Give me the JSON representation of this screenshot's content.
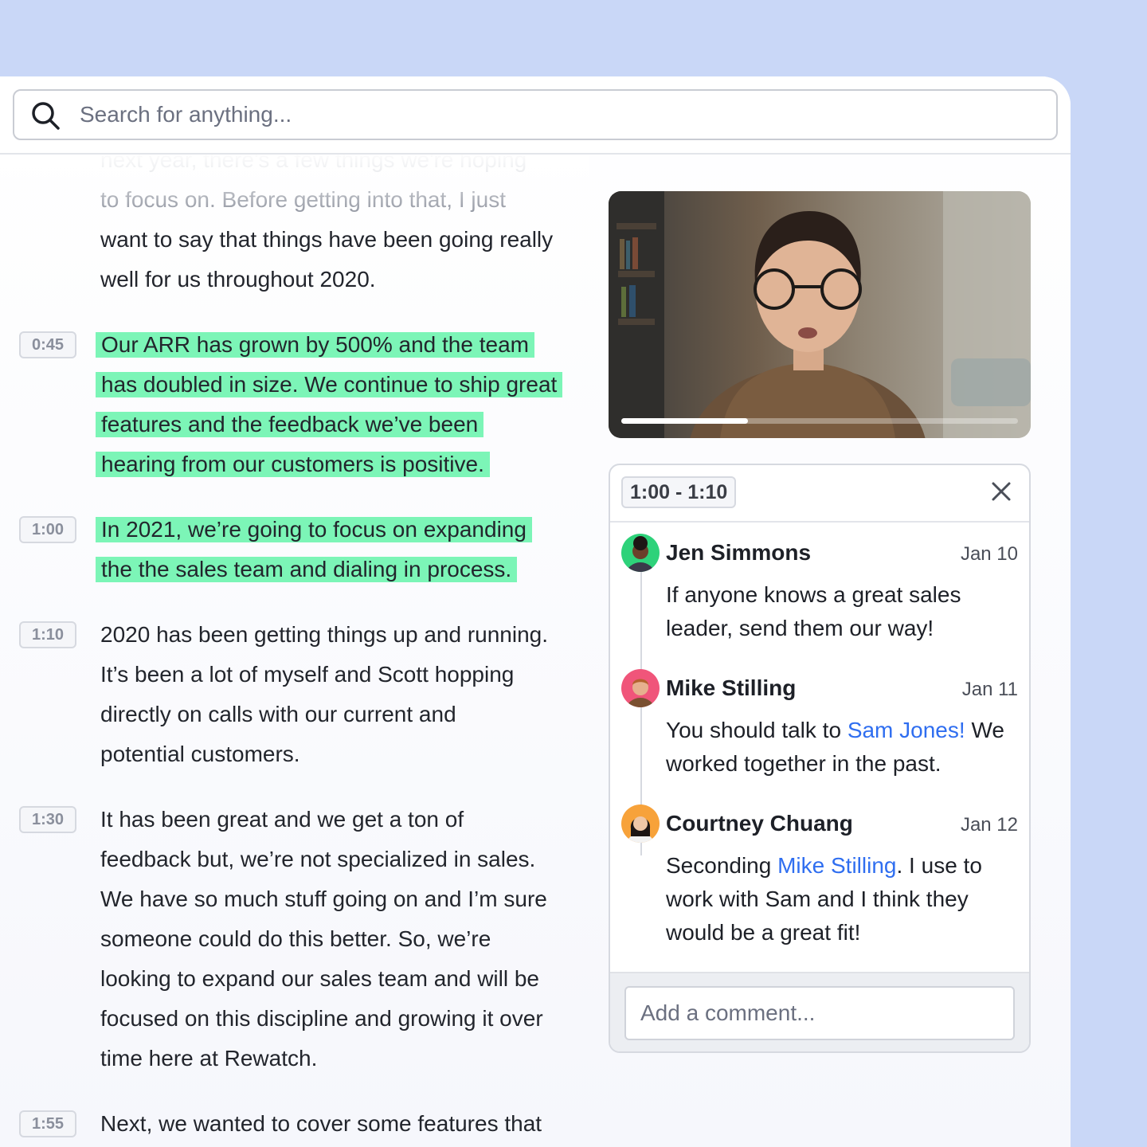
{
  "search": {
    "placeholder": "Search for anything..."
  },
  "transcript": {
    "intro_lines": [
      "next year, there's a few things we're hoping",
      "to focus on. Before getting into that, I just",
      "want to say that things have been going really",
      "well for us throughout 2020."
    ],
    "segments": [
      {
        "time": "0:45",
        "lines": [
          "Our ARR has grown by 500% and the team",
          "has doubled in size. We continue to ship great",
          "features and the feedback we’ve been",
          "hearing from our customers is positive."
        ]
      },
      {
        "time": "1:00",
        "lines": [
          "In 2021, we’re going to focus on  expanding",
          "the the sales team and dialing in process."
        ]
      },
      {
        "time": "1:10",
        "lines": [
          "2020 has been getting things up and running.",
          "It’s been a lot of myself and Scott hopping",
          "directly on calls with our current and",
          "potential customers."
        ]
      },
      {
        "time": "1:30",
        "lines": [
          "It has been great and we get a ton of",
          "feedback but, we’re not specialized in sales.",
          "We have so much stuff going on and I’m sure",
          "someone could do this better. So, we’re",
          "looking to expand our sales team and will be",
          "focused on this discipline and growing it over",
          "time here at Rewatch."
        ]
      },
      {
        "time": "1:55",
        "lines": [
          "Next, we wanted to cover some features that"
        ]
      }
    ]
  },
  "video": {
    "progress_percent": 32
  },
  "comments": {
    "range": "1:00 - 1:10",
    "input_placeholder": "Add a comment...",
    "items": [
      {
        "name": "Jen Simmons",
        "date": "Jan 10",
        "text_before": "If anyone knows a great sales leader, send them our way!",
        "mention": "",
        "text_after": ""
      },
      {
        "name": "Mike Stilling",
        "date": "Jan 11",
        "text_before": "You should talk to ",
        "mention": "Sam Jones!",
        "text_after": " We worked together in the past."
      },
      {
        "name": "Courtney Chuang",
        "date": "Jan 12",
        "text_before": "Seconding ",
        "mention": "Mike Stilling",
        "text_after": ". I use to work with Sam and I think they would be a great fit!"
      }
    ]
  },
  "colors": {
    "highlight": "#7cf5b7",
    "mention": "#2f6ef0",
    "background": "#c9d7f7"
  }
}
